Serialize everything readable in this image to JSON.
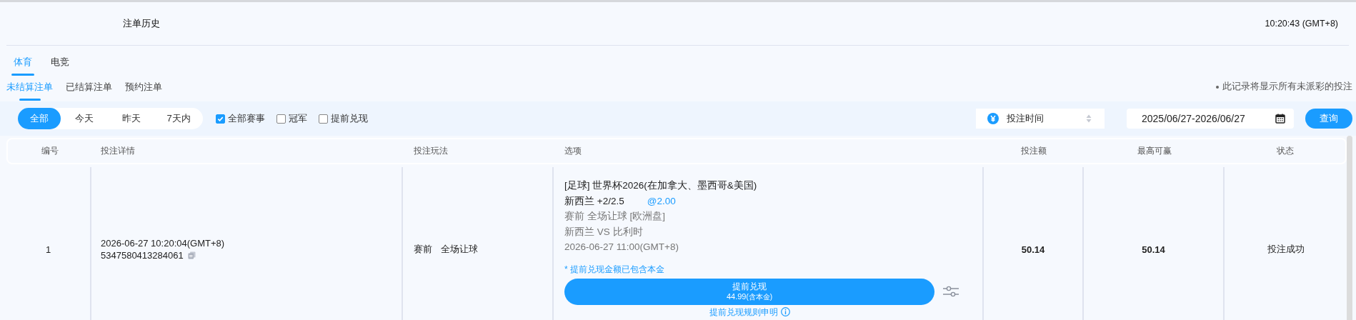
{
  "header": {
    "title": "注单历史",
    "clock": "10:20:43 (GMT+8)"
  },
  "tabs": [
    {
      "label": "体育",
      "selected": true
    },
    {
      "label": "电竞",
      "selected": false
    }
  ],
  "sub_tabs": [
    {
      "label": "未结算注单",
      "selected": true
    },
    {
      "label": "已结算注单",
      "selected": false
    },
    {
      "label": "预约注单",
      "selected": false
    }
  ],
  "notice": "此记录将显示所有未派彩的投注",
  "filters": {
    "periods": [
      {
        "label": "全部",
        "selected": true
      },
      {
        "label": "今天",
        "selected": false
      },
      {
        "label": "昨天",
        "selected": false
      },
      {
        "label": "7天内",
        "selected": false
      }
    ],
    "checkboxes": [
      {
        "label": "全部赛事",
        "checked": true
      },
      {
        "label": "冠军",
        "checked": false
      },
      {
        "label": "提前兑现",
        "checked": false
      }
    ],
    "sort": {
      "value": "投注时间"
    },
    "date_range": {
      "value": "2025/06/27-2026/06/27"
    },
    "query_button": "查询"
  },
  "table": {
    "columns": [
      "编号",
      "投注详情",
      "投注玩法",
      "选项",
      "投注额",
      "最高可赢",
      "状态"
    ],
    "rows": [
      {
        "index": "1",
        "bet_time": "2026-06-27 10:20:04(GMT+8)",
        "bet_id": "5347580413284061",
        "play_stage": "赛前",
        "play_type": "全场让球",
        "league": "[足球] 世界杯2026(在加拿大、墨西哥&美国)",
        "pick": "新西兰 +2/2.5",
        "odds": "@2.00",
        "market": "赛前 全场让球 [欧洲盘]",
        "match": "新西兰 VS 比利时",
        "kickoff": "2026-06-27 11:00(GMT+8)",
        "cashout_note": "* 提前兑现金额已包含本金",
        "cashout": {
          "label": "提前兑现",
          "amount": "44.99",
          "amount_note": "(含本金)"
        },
        "rules_link": "提前兑现规则申明",
        "stake": "50.14",
        "max_win": "50.14",
        "status": "投注成功"
      }
    ]
  }
}
